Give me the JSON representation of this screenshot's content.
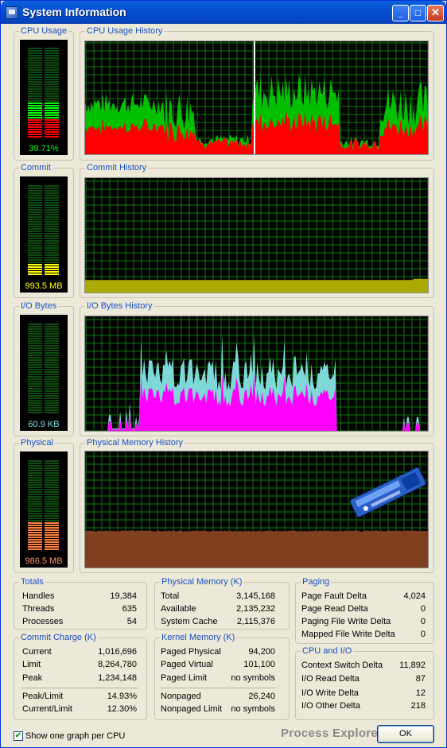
{
  "window": {
    "title": "System Information"
  },
  "titlebar": {
    "minimize": "_",
    "maximize": "□",
    "close": "✕"
  },
  "graphs": {
    "cpu_usage": {
      "label": "CPU Usage",
      "value": "39.71%",
      "level": 0.3971,
      "color": "#00ff00"
    },
    "cpu_history": {
      "label": "CPU Usage History",
      "series": [
        {
          "color": "#00c000"
        },
        {
          "color": "#ff0000"
        }
      ]
    },
    "commit": {
      "label": "Commit",
      "value": "993.5 MB",
      "level": 0.1185,
      "color": "#ffff00"
    },
    "commit_history": {
      "label": "Commit History",
      "color": "#aaaa00"
    },
    "io_bytes": {
      "label": "I/O Bytes",
      "value": "60.9  KB",
      "level": 0.0,
      "color": "#00ffff"
    },
    "io_history": {
      "label": "I/O Bytes History",
      "series": [
        {
          "color": "#7fd8d8"
        },
        {
          "color": "#ff00ff"
        }
      ]
    },
    "physical": {
      "label": "Physical",
      "value": "986.5 MB",
      "level": 0.3213,
      "color": "#ff8040"
    },
    "physical_history": {
      "label": "Physical Memory History",
      "color": "#804020"
    }
  },
  "totals": {
    "label": "Totals",
    "rows": [
      {
        "name": "Handles",
        "value": "19,384"
      },
      {
        "name": "Threads",
        "value": "635"
      },
      {
        "name": "Processes",
        "value": "54"
      }
    ]
  },
  "physical_memory": {
    "label": "Physical Memory (K)",
    "rows": [
      {
        "name": "Total",
        "value": "3,145,168"
      },
      {
        "name": "Available",
        "value": "2,135,232"
      },
      {
        "name": "System Cache",
        "value": "2,115,376"
      }
    ]
  },
  "paging": {
    "label": "Paging",
    "rows": [
      {
        "name": "Page Fault Delta",
        "value": "4,024"
      },
      {
        "name": "Page Read Delta",
        "value": "0"
      },
      {
        "name": "Paging File Write Delta",
        "value": "0"
      },
      {
        "name": "Mapped File Write Delta",
        "value": "0"
      }
    ]
  },
  "commit_charge": {
    "label": "Commit Charge (K)",
    "rows": [
      {
        "name": "Current",
        "value": "1,016,696"
      },
      {
        "name": "Limit",
        "value": "8,264,780"
      },
      {
        "name": "Peak",
        "value": "1,234,148"
      }
    ],
    "rows2": [
      {
        "name": "Peak/Limit",
        "value": "14.93%"
      },
      {
        "name": "Current/Limit",
        "value": "12.30%"
      }
    ]
  },
  "kernel_memory": {
    "label": "Kernel Memory (K)",
    "rows": [
      {
        "name": "Paged Physical",
        "value": "94,200"
      },
      {
        "name": "Paged Virtual",
        "value": "101,100"
      },
      {
        "name": "Paged Limit",
        "value": "no symbols"
      }
    ],
    "rows2": [
      {
        "name": "Nonpaged",
        "value": "26,240"
      },
      {
        "name": "Nonpaged Limit",
        "value": "no symbols"
      }
    ]
  },
  "cpu_io": {
    "label": "CPU and I/O",
    "rows": [
      {
        "name": "Context Switch Delta",
        "value": "11,892"
      },
      {
        "name": "I/O Read Delta",
        "value": "87"
      },
      {
        "name": "I/O Write Delta",
        "value": "12"
      },
      {
        "name": "I/O Other Delta",
        "value": "218"
      }
    ]
  },
  "footer": {
    "checkbox_label": "Show one graph per CPU",
    "checkbox_checked": true,
    "check_mark": "✔",
    "brand": "Process Explorer",
    "ok_label": "OK"
  }
}
